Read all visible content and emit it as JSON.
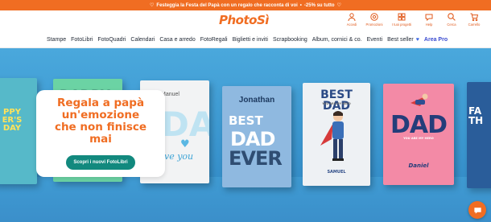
{
  "promo": {
    "text": "Festeggia la Festa del Papà con un regalo che racconta di voi",
    "offer": "-25% su tutto"
  },
  "header": {
    "logo": "PhotoSì",
    "actions": [
      {
        "label": "Accedi",
        "icon": "user-icon"
      },
      {
        "label": "Promozioni",
        "icon": "gear-badge-icon"
      },
      {
        "label": "I tuoi progetti",
        "icon": "projects-icon"
      },
      {
        "label": "Help",
        "icon": "help-icon"
      },
      {
        "label": "Cerca",
        "icon": "search-icon"
      },
      {
        "label": "Carrello",
        "icon": "cart-icon"
      }
    ]
  },
  "nav": {
    "items": [
      "Stampe",
      "FotoLibri",
      "FotoQuadri",
      "Calendari",
      "Casa e arredo",
      "FotoRegali",
      "Biglietti e inviti",
      "Scrapbooking",
      "Album, cornici & co.",
      "Eventi",
      "Best seller"
    ],
    "pro": "Area Pro"
  },
  "hero": {
    "title": "Regala a papà\nun'emozione\nche non finisce\nmai",
    "cta": "Scopri i nuovi FotoLibri",
    "books": {
      "b1": "PPY\nER'S DAY",
      "b2": "DADDY",
      "b3_name": "Manuel",
      "b3_big": "DA",
      "b3_you": "ve you",
      "b4_name": "Jonathan",
      "b4_best": "BEST",
      "b4_dad": "DAD",
      "b4_ever": "EVER",
      "b5_title": "BEST DAD",
      "b5_sub": "YOU ARE MY HERO",
      "b5_name": "SAMUEL",
      "b6_dad": "DAD",
      "b6_sub": "YOU ARE MY HERO",
      "b6_name": "Daniel",
      "b7": "FA\nTH"
    }
  },
  "colors": {
    "brand": "#f06d22",
    "cta": "#12897e",
    "pro": "#3a4bd0"
  }
}
